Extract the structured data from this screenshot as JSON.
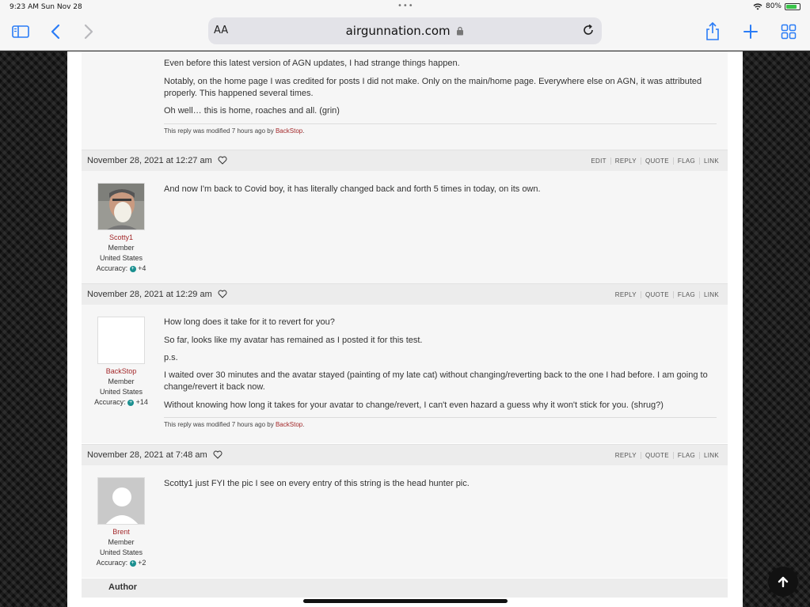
{
  "status": {
    "time": "9:23 AM  Sun Nov 28",
    "battery": "80%",
    "battery_level": 0.8
  },
  "browser": {
    "aa": "AA",
    "host": "airgunnation.com"
  },
  "posts": [
    {
      "paragraphs": [
        "Even before this latest version of AGN updates, I had strange things happen.",
        "Notably, on the home page I was credited for posts I did not make.  Only on the main/home page.  Everywhere else on AGN, it was attributed properly.  This happened several times.",
        "Oh well…  this is home, roaches and all. (grin)"
      ],
      "modified_prefix": "This reply was modified 7 hours ago by ",
      "modified_by": "BackStop",
      "modified_suffix": "."
    },
    {
      "date": "November 28, 2021 at 12:27 am",
      "actions": [
        "EDIT",
        "REPLY",
        "QUOTE",
        "FLAG",
        "LINK"
      ],
      "author": {
        "name": "Scotty1",
        "role": "Member",
        "country": "United States",
        "accuracy_label": "Accuracy:",
        "accuracy": "+4"
      },
      "paragraphs": [
        "And now I'm back to Covid boy, it has literally changed back and forth 5 times in today, on its own."
      ]
    },
    {
      "date": "November 28, 2021 at 12:29 am",
      "actions": [
        "REPLY",
        "QUOTE",
        "FLAG",
        "LINK"
      ],
      "author": {
        "name": "BackStop",
        "role": "Member",
        "country": "United States",
        "accuracy_label": "Accuracy:",
        "accuracy": "+14"
      },
      "paragraphs": [
        "How long does it take for it to revert for you?",
        "So far, looks like my avatar has remained as I posted it for this test.",
        "p.s.",
        "I waited over 30 minutes and the avatar stayed (painting of my late cat) without changing/reverting back to the one I had before.  I am going to change/revert it back now.",
        "Without knowing how long it takes for your avatar to change/revert, I can't even hazard a guess why it won't stick for you. (shrug?)"
      ],
      "modified_prefix": "This reply was modified 7 hours ago by ",
      "modified_by": "BackStop",
      "modified_suffix": "."
    },
    {
      "date": "November 28, 2021 at 7:48 am",
      "actions": [
        "REPLY",
        "QUOTE",
        "FLAG",
        "LINK"
      ],
      "author": {
        "name": "Brent",
        "role": "Member",
        "country": "United States",
        "accuracy_label": "Accuracy:",
        "accuracy": "+2"
      },
      "paragraphs": [
        "Scotty1 just FYI  the pic I see on every entry of this string is the head hunter pic."
      ]
    }
  ],
  "author_bar": "Author"
}
